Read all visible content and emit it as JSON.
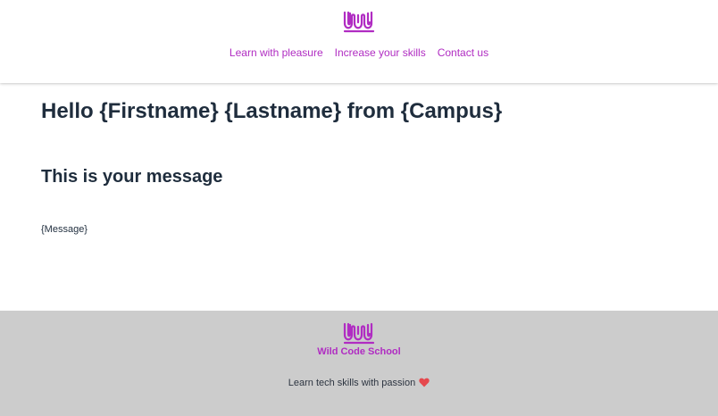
{
  "header": {
    "logo_icon": "wild-code-school-logo",
    "nav": [
      {
        "label": "Learn with pleasure"
      },
      {
        "label": "Increase your skills"
      },
      {
        "label": "Contact us"
      }
    ]
  },
  "main": {
    "title": "Hello {Firstname} {Lastname} from {Campus}",
    "subtitle": "This is your message",
    "message": "{Message}"
  },
  "footer": {
    "logo_icon": "wild-code-school-logo",
    "brand": "Wild Code School",
    "tagline": "Learn tech skills with passion",
    "heart_icon": "heart-icon"
  },
  "colors": {
    "accent": "#b02cc2",
    "text": "#1f2d3d",
    "footer_bg": "#cccccc",
    "heart": "#e5484d"
  }
}
